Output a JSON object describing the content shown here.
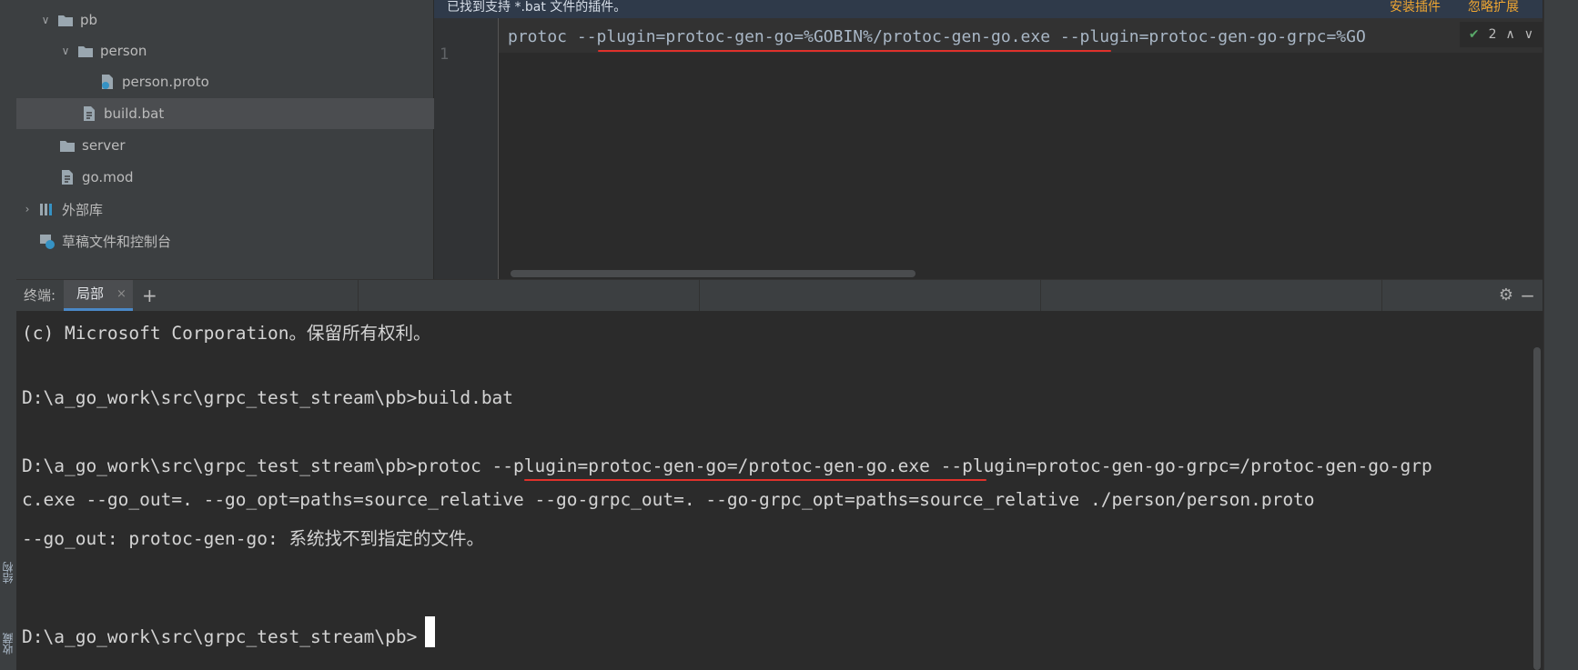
{
  "left_strip": {
    "tab_structure": "结构",
    "tab_favorites": "收藏"
  },
  "project_tree": {
    "items": [
      {
        "label": "pb",
        "kind": "folder",
        "expanded": true
      },
      {
        "label": "person",
        "kind": "folder",
        "expanded": true
      },
      {
        "label": "person.proto",
        "kind": "proto-file"
      },
      {
        "label": "build.bat",
        "kind": "bat-file",
        "selected": true
      },
      {
        "label": "server",
        "kind": "folder"
      },
      {
        "label": "go.mod",
        "kind": "file"
      },
      {
        "label": "外部库",
        "kind": "library",
        "collapsed": true
      },
      {
        "label": "草稿文件和控制台",
        "kind": "scratch"
      }
    ]
  },
  "editor": {
    "notification": "已找到支持 *.bat 文件的插件。",
    "action_install": "安装插件",
    "action_ignore": "忽略扩展",
    "line_number": "1",
    "code": "protoc --plugin=protoc-gen-go=%GOBIN%/protoc-gen-go.exe --plugin=protoc-gen-go-grpc=%GO",
    "inspection_count": "2"
  },
  "terminal_tabs": {
    "label": "终端:",
    "tab_local": "局部",
    "close_glyph": "×",
    "add_glyph": "+"
  },
  "terminal": {
    "lines": [
      "(c) Microsoft Corporation。保留所有权利。",
      "",
      "D:\\a_go_work\\src\\grpc_test_stream\\pb>build.bat",
      "",
      "D:\\a_go_work\\src\\grpc_test_stream\\pb>protoc --plugin=protoc-gen-go=/protoc-gen-go.exe --plugin=protoc-gen-go-grpc=/protoc-gen-go-grp",
      "c.exe --go_out=. --go_opt=paths=source_relative --go-grpc_out=. --go-grpc_opt=paths=source_relative ./person/person.proto",
      "--go_out: protoc-gen-go: 系统找不到指定的文件。",
      "",
      "",
      "D:\\a_go_work\\src\\grpc_test_stream\\pb>"
    ]
  },
  "colors": {
    "annotation_red": "#e0312b",
    "accent_blue": "#4a88c7"
  }
}
